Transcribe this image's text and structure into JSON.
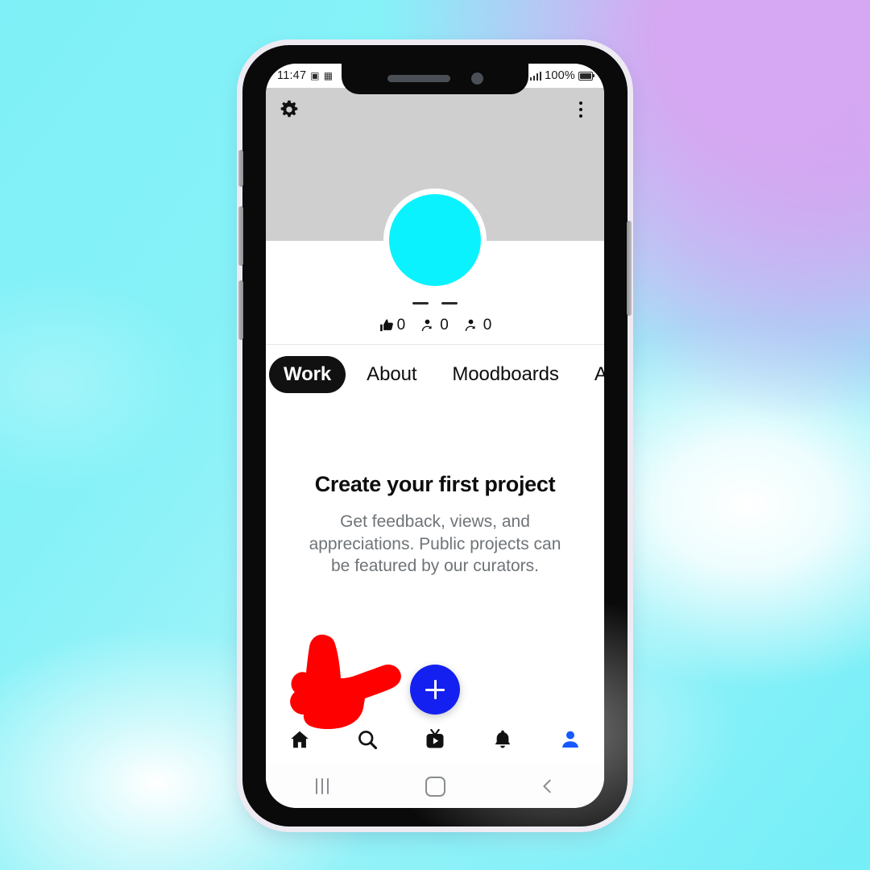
{
  "background": {
    "description": "pastel cyan to lavender gradient backdrop",
    "cyan": "#86f2f8",
    "lavender": "#d6a7f2"
  },
  "device": {
    "frame_color": "#0a0a0a",
    "bezel_color": "#eeeaf2",
    "buttons": [
      {
        "name": "volume-up-button",
        "side": "left"
      },
      {
        "name": "volume-down-button",
        "side": "left"
      },
      {
        "name": "bixby-button",
        "side": "left"
      },
      {
        "name": "power-button",
        "side": "right"
      }
    ]
  },
  "status_bar": {
    "time": "11:47",
    "battery_percent": "100%",
    "icons": [
      "image-icon",
      "sim-icon",
      "signal-icon",
      "battery-icon"
    ]
  },
  "profile_header": {
    "settings_icon": "gear-icon",
    "overflow_icon": "kebab-menu-icon",
    "cover_color": "#cfcfcf",
    "avatar_color": "#0bf2ff",
    "avatar_label": "profile-avatar"
  },
  "stats": [
    {
      "icon": "thumbs-up-icon",
      "label": "appreciations",
      "value": "0"
    },
    {
      "icon": "followers-icon",
      "label": "followers",
      "value": "0"
    },
    {
      "icon": "following-icon",
      "label": "following",
      "value": "0"
    }
  ],
  "tabs": [
    {
      "label": "Work",
      "active": true
    },
    {
      "label": "About",
      "active": false
    },
    {
      "label": "Moodboards",
      "active": false
    },
    {
      "label": "A",
      "active": false
    }
  ],
  "empty_state": {
    "title": "Create your first project",
    "subtitle": "Get feedback, views, and appreciations. Public projects can be featured by our curators."
  },
  "fab": {
    "icon": "plus-icon",
    "label": "create-project",
    "color": "#1420f0"
  },
  "pointer": {
    "icon": "pointing-hand-cursor",
    "color": "#fe0000",
    "points_at": "create-project-fab"
  },
  "app_nav": [
    {
      "name": "home",
      "icon": "home-icon",
      "active": false,
      "color": "#111111"
    },
    {
      "name": "search",
      "icon": "search-icon",
      "active": false,
      "color": "#111111"
    },
    {
      "name": "live",
      "icon": "tv-icon",
      "active": false,
      "color": "#111111"
    },
    {
      "name": "notifications",
      "icon": "bell-icon",
      "active": false,
      "color": "#111111"
    },
    {
      "name": "profile",
      "icon": "person-icon",
      "active": true,
      "color": "#1559ff"
    }
  ],
  "system_nav": [
    {
      "name": "recents",
      "icon": "recents-icon"
    },
    {
      "name": "home",
      "icon": "home-square-icon"
    },
    {
      "name": "back",
      "icon": "back-chevron-icon"
    }
  ]
}
